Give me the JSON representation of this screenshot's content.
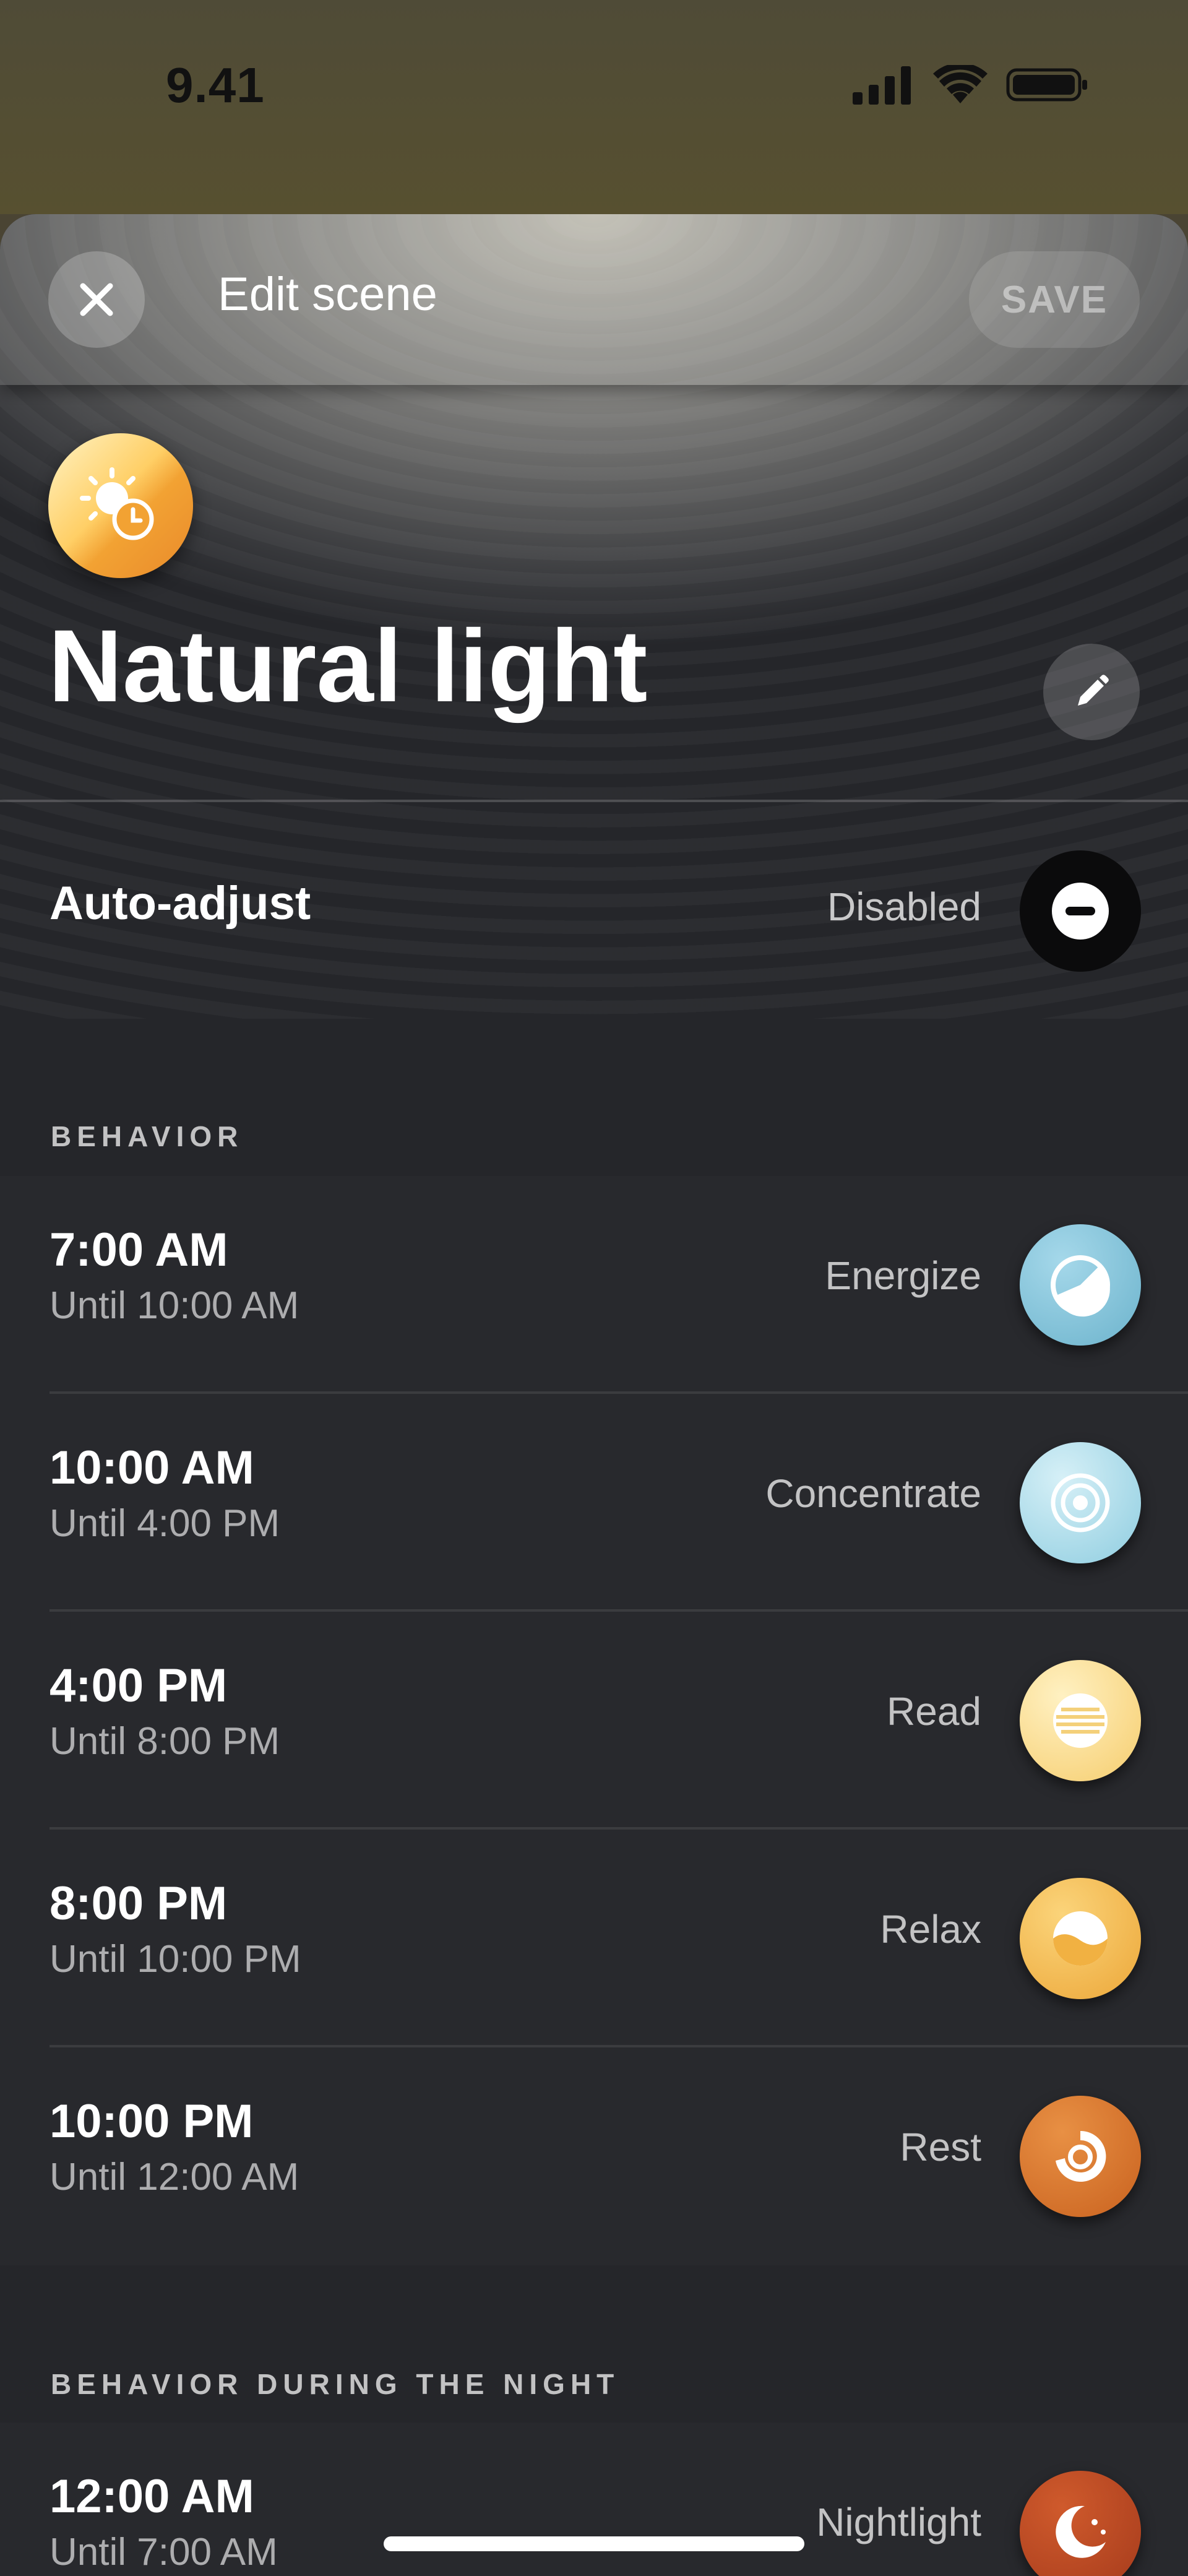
{
  "status_bar": {
    "time": "9.41"
  },
  "header": {
    "title": "Edit scene",
    "save_label": "SAVE"
  },
  "scene": {
    "name": "Natural light"
  },
  "auto_adjust": {
    "label": "Auto-adjust",
    "value": "Disabled"
  },
  "behavior": {
    "title": "BEHAVIOR",
    "rows": [
      {
        "time": "7:00 AM",
        "until": "Until 10:00 AM",
        "scene": "Energize",
        "icon": "energize-icon",
        "color": "#7ec3d9"
      },
      {
        "time": "10:00 AM",
        "until": "Until 4:00 PM",
        "scene": "Concentrate",
        "icon": "concentrate-icon",
        "color": "#a9dcea"
      },
      {
        "time": "4:00 PM",
        "until": "Until 8:00 PM",
        "scene": "Read",
        "icon": "read-icon",
        "color": "#f8d98a"
      },
      {
        "time": "8:00 PM",
        "until": "Until 10:00 PM",
        "scene": "Relax",
        "icon": "relax-icon",
        "color": "#f2b547"
      },
      {
        "time": "10:00 PM",
        "until": "Until 12:00 AM",
        "scene": "Rest",
        "icon": "rest-icon",
        "color": "#d9742a"
      }
    ]
  },
  "night": {
    "title": "BEHAVIOR DURING THE NIGHT",
    "rows": [
      {
        "time": "12:00 AM",
        "until": "Until 7:00 AM",
        "scene": "Nightlight",
        "icon": "nightlight-icon",
        "color": "#b84a24"
      }
    ]
  }
}
